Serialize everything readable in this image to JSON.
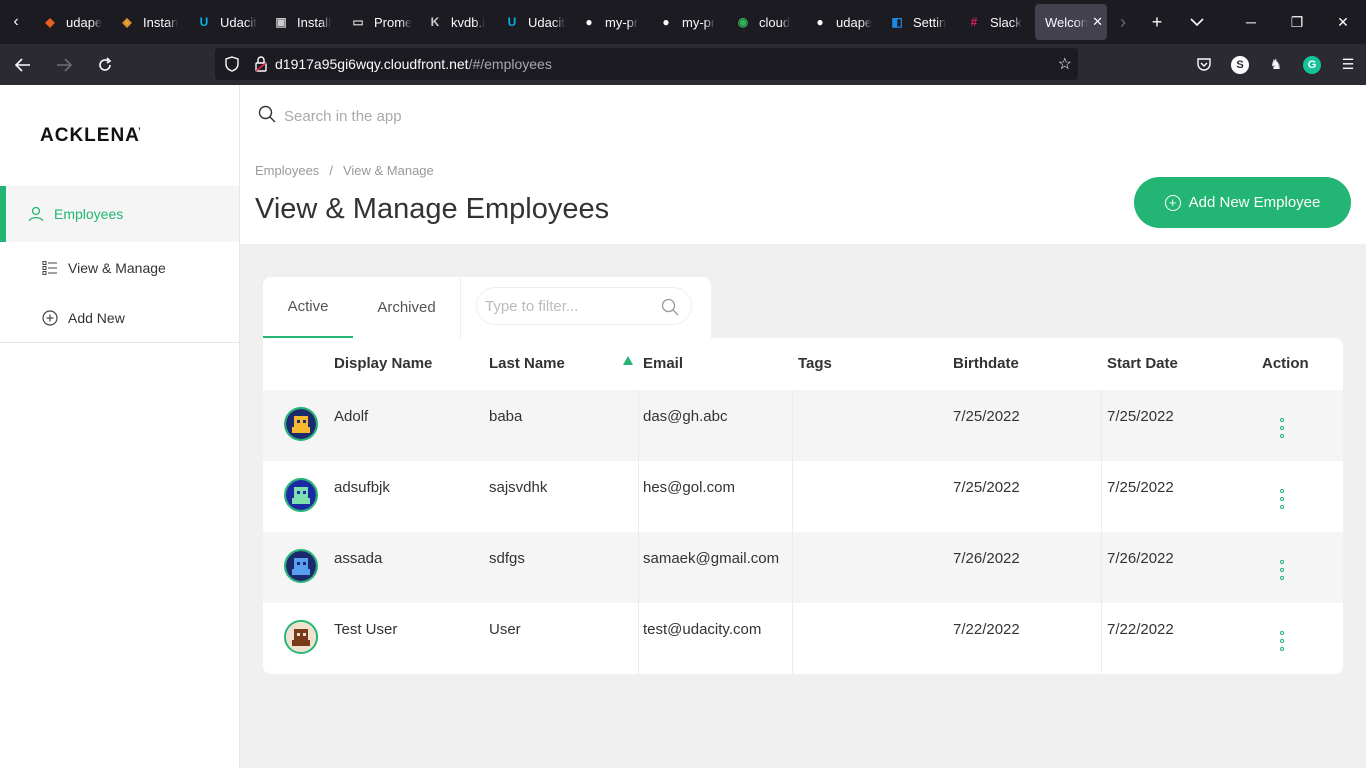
{
  "browser": {
    "tabs": [
      {
        "label": "udape",
        "icon": "udacity-orange-icon",
        "color": "#e8621f"
      },
      {
        "label": "Instan",
        "icon": "aws-cube-icon",
        "color": "#f0a030"
      },
      {
        "label": "Udacit",
        "icon": "udacity-icon",
        "color": "#02b3e4"
      },
      {
        "label": "Install",
        "icon": "terminal-icon",
        "color": "#cccccc"
      },
      {
        "label": "Prome",
        "icon": "page-icon",
        "color": "#cccccc"
      },
      {
        "label": "kvdb.i",
        "icon": "kvdb-icon",
        "color": "#cccccc"
      },
      {
        "label": "Udacit",
        "icon": "udacity-icon",
        "color": "#02b3e4"
      },
      {
        "label": "my-pr",
        "icon": "github-icon",
        "color": "#ffffff"
      },
      {
        "label": "my-pr",
        "icon": "github-icon",
        "color": "#ffffff"
      },
      {
        "label": "cloud",
        "icon": "cloud-green-icon",
        "color": "#2fb45a"
      },
      {
        "label": "udape",
        "icon": "github-icon",
        "color": "#ffffff"
      },
      {
        "label": "Settin",
        "icon": "settings-blue-icon",
        "color": "#1e88e5"
      },
      {
        "label": "Slack",
        "icon": "slack-icon",
        "color": "#e01e5a"
      }
    ],
    "active_tab": {
      "label": "Welcon"
    },
    "url_host": "d1917a95gi6wqy.cloudfront.net",
    "url_path": "/#/employees"
  },
  "app": {
    "logo": "ACKLENAVENUE",
    "accent": "#22b573",
    "search_placeholder": "Search in the app",
    "sidebar": {
      "items": [
        {
          "label": "Employees",
          "icon": "user-icon",
          "active": true
        },
        {
          "label": "View & Manage",
          "icon": "list-icon",
          "active": false
        },
        {
          "label": "Add New",
          "icon": "plus-circle-icon",
          "active": false
        }
      ]
    },
    "breadcrumb": {
      "first": "Employees",
      "sep": "/",
      "second": "View & Manage"
    },
    "page_title": "View & Manage Employees",
    "add_button": "Add New Employee",
    "tabs": {
      "active": "Active",
      "archived": "Archived"
    },
    "filter_placeholder": "Type to filter...",
    "columns": {
      "display_name": "Display Name",
      "last_name": "Last Name",
      "email": "Email",
      "tags": "Tags",
      "birthdate": "Birthdate",
      "start_date": "Start Date",
      "action": "Action"
    },
    "rows": [
      {
        "display_name": "Adolf",
        "last_name": "baba",
        "email": "das@gh.abc",
        "tags": "",
        "birthdate": "7/25/2022",
        "start_date": "7/25/2022",
        "avatar_color": "#f5b82e",
        "avatar_bg": "#1a2a6c"
      },
      {
        "display_name": "adsufbjk",
        "last_name": "sajsvdhk",
        "email": "hes@gol.com",
        "tags": "",
        "birthdate": "7/25/2022",
        "start_date": "7/25/2022",
        "avatar_color": "#7ee0b0",
        "avatar_bg": "#1a2aa0"
      },
      {
        "display_name": "assada",
        "last_name": "sdfgs",
        "email": "samaek@gmail.com",
        "tags": "",
        "birthdate": "7/26/2022",
        "start_date": "7/26/2022",
        "avatar_color": "#5aa0f0",
        "avatar_bg": "#1a2a6c"
      },
      {
        "display_name": "Test User",
        "last_name": "User",
        "email": "test@udacity.com",
        "tags": "",
        "birthdate": "7/22/2022",
        "start_date": "7/22/2022",
        "avatar_color": "#7a3a1a",
        "avatar_bg": "#f0e0d0"
      }
    ]
  }
}
